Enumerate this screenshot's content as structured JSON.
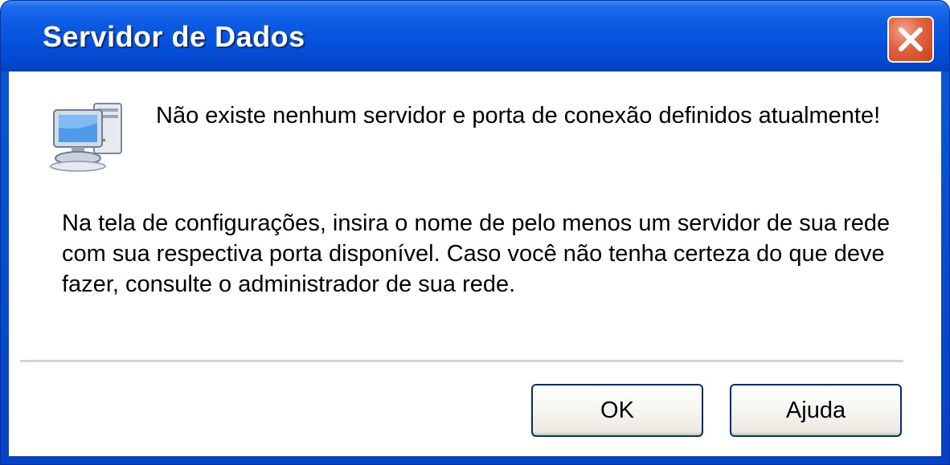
{
  "window": {
    "title": "Servidor de Dados",
    "close_icon": "close-icon"
  },
  "dialog": {
    "icon": "computer-network-icon",
    "message": "Não existe nenhum servidor e porta de conexão definidos atualmente!",
    "details": "Na tela de configurações, insira o nome de pelo menos um servidor de sua rede com sua respectiva porta disponível. Caso você não tenha certeza do que deve fazer, consulte o administrador de sua rede."
  },
  "buttons": {
    "ok_label": "OK",
    "help_label": "Ajuda"
  },
  "colors": {
    "titlebar": "#0552dc",
    "close_button": "#e0623f",
    "button_border": "#00316e"
  }
}
